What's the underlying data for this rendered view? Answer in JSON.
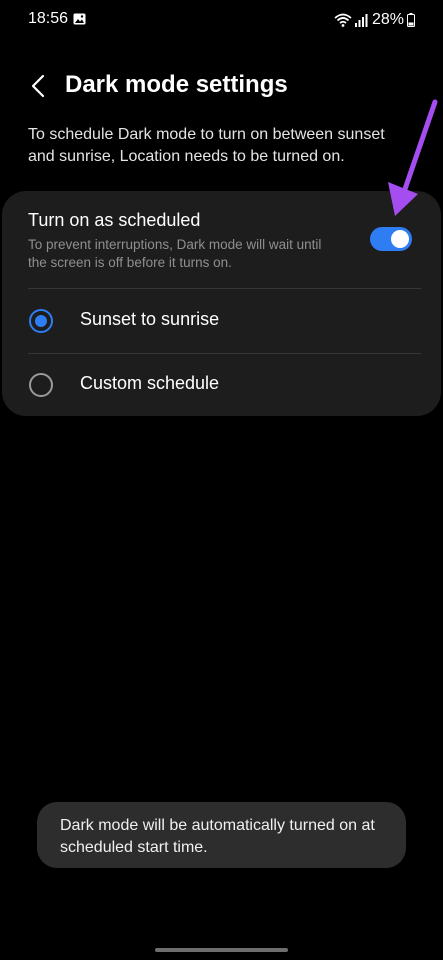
{
  "status_bar": {
    "time": "18:56",
    "battery": "28%",
    "icons": [
      "gallery-icon",
      "wifi-icon",
      "signal-icon",
      "battery-icon"
    ]
  },
  "header": {
    "back_icon": "chevron-left-icon",
    "title": "Dark mode settings"
  },
  "description": "To schedule Dark mode to turn on between sunset and sunrise, Location needs to be turned on.",
  "schedule": {
    "title": "Turn on as scheduled",
    "subtitle": "To prevent interruptions, Dark mode will wait until the screen is off before it turns on.",
    "enabled": true
  },
  "options": [
    {
      "label": "Sunset to sunrise",
      "selected": true
    },
    {
      "label": "Custom schedule",
      "selected": false
    }
  ],
  "toast": {
    "message": "Dark mode will be automatically turned on at scheduled start time."
  },
  "colors": {
    "background": "#000000",
    "card": "#1d1d1d",
    "accent": "#2f7df2",
    "annotation_arrow": "#a54df0",
    "toast": "#2d2d2d"
  }
}
